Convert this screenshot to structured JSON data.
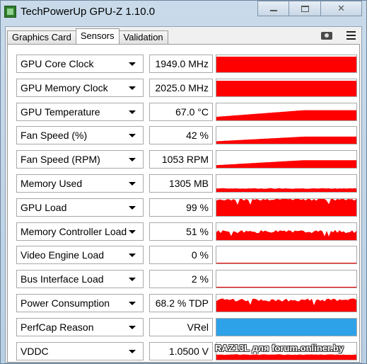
{
  "window": {
    "title": "TechPowerUp GPU-Z 1.10.0",
    "minimize_icon": "minimize-icon",
    "maximize_icon": "maximize-icon",
    "close_icon": "close-icon"
  },
  "tabs": [
    {
      "label": "Graphics Card",
      "active": false
    },
    {
      "label": "Sensors",
      "active": true
    },
    {
      "label": "Validation",
      "active": false
    }
  ],
  "toolbar": {
    "screenshot_icon": "camera-icon",
    "menu_icon": "hamburger-menu-icon"
  },
  "colors": {
    "graph_red": "#ff0000",
    "graph_blue": "#2ea2e8"
  },
  "sensors": [
    {
      "label": "GPU Core Clock",
      "value": "1949.0 MHz",
      "graph": "full",
      "level": 1.0
    },
    {
      "label": "GPU Memory Clock",
      "value": "2025.0 MHz",
      "graph": "full",
      "level": 1.0
    },
    {
      "label": "GPU Temperature",
      "value": "67.0 °C",
      "graph": "rising",
      "level": 0.6
    },
    {
      "label": "Fan Speed (%)",
      "value": "42 %",
      "graph": "rising",
      "level": 0.42
    },
    {
      "label": "Fan Speed (RPM)",
      "value": "1053 RPM",
      "graph": "rising",
      "level": 0.45
    },
    {
      "label": "Memory Used",
      "value": "1305 MB",
      "graph": "low",
      "level": 0.2
    },
    {
      "label": "GPU Load",
      "value": "99 %",
      "graph": "noisy",
      "level": 0.99
    },
    {
      "label": "Memory Controller Load",
      "value": "51 %",
      "graph": "noisy",
      "level": 0.5
    },
    {
      "label": "Video Engine Load",
      "value": "0 %",
      "graph": "empty",
      "level": 0.0
    },
    {
      "label": "Bus Interface Load",
      "value": "2 %",
      "graph": "empty",
      "level": 0.02
    },
    {
      "label": "Power Consumption",
      "value": "68.2 % TDP",
      "graph": "noisy",
      "level": 0.68
    },
    {
      "label": "PerfCap Reason",
      "value": "VRel",
      "graph": "blue",
      "level": 1.0
    },
    {
      "label": "VDDC",
      "value": "1.0500 V",
      "graph": "low",
      "level": 0.3
    }
  ],
  "watermark": "RAZ13L для forum.onliner.by"
}
